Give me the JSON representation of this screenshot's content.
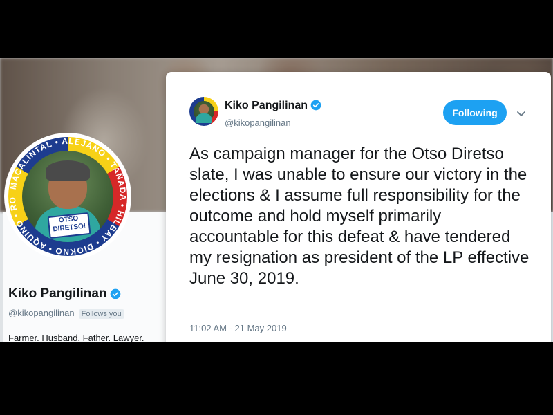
{
  "profile": {
    "name": "Kiko Pangilinan",
    "handle": "@kikopangilinan",
    "follows_you": "Follows you",
    "bio": "Farmer. Husband. Father. Lawyer.",
    "avatar_ring_text": [
      "MACALINTAL",
      "ALEJANO",
      "TAÑADA",
      "HILBAY",
      "DIOKNO",
      "AQUINO",
      "ROXAS",
      "GUTOC"
    ],
    "avatar_badge": [
      "OTSO",
      "DIRETSO!"
    ]
  },
  "tweet": {
    "author_name": "Kiko Pangilinan",
    "author_handle": "@kikopangilinan",
    "follow_label": "Following",
    "text": "As campaign manager for the Otso Diretso slate, I was unable to ensure our victory in the elections & I assume full responsibility for the outcome and hold myself primarily accountable for this defeat & have tendered my resignation as president of the LP effective June 30, 2019.",
    "timestamp": "11:02 AM - 21 May 2019"
  },
  "colors": {
    "accent": "#1da1f2",
    "verified": "#1da1f2",
    "text": "#14171a",
    "muted": "#657786"
  },
  "icons": {
    "verified": "verified-badge-icon",
    "caret": "chevron-down-icon"
  }
}
